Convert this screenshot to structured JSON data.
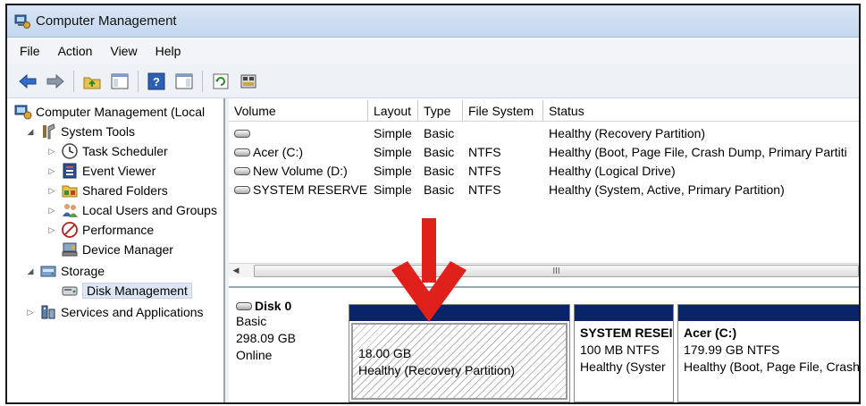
{
  "window": {
    "title": "Computer Management"
  },
  "menu": [
    "File",
    "Action",
    "View",
    "Help"
  ],
  "tree": {
    "root": "Computer Management (Local",
    "system_tools": "System Tools",
    "task_scheduler": "Task Scheduler",
    "event_viewer": "Event Viewer",
    "shared_folders": "Shared Folders",
    "local_users": "Local Users and Groups",
    "performance": "Performance",
    "device_manager": "Device Manager",
    "storage": "Storage",
    "disk_management": "Disk Management",
    "services": "Services and Applications"
  },
  "volumes": {
    "columns": [
      "Volume",
      "Layout",
      "Type",
      "File System",
      "Status"
    ],
    "rows": [
      {
        "volume": "",
        "layout": "Simple",
        "type": "Basic",
        "fs": "",
        "status": "Healthy (Recovery Partition)"
      },
      {
        "volume": "Acer (C:)",
        "layout": "Simple",
        "type": "Basic",
        "fs": "NTFS",
        "status": "Healthy (Boot, Page File, Crash Dump, Primary Partiti"
      },
      {
        "volume": "New Volume (D:)",
        "layout": "Simple",
        "type": "Basic",
        "fs": "NTFS",
        "status": "Healthy (Logical Drive)"
      },
      {
        "volume": "SYSTEM RESERVED",
        "layout": "Simple",
        "type": "Basic",
        "fs": "NTFS",
        "status": "Healthy (System, Active, Primary Partition)"
      }
    ]
  },
  "scroll": {
    "grip": "III"
  },
  "disk": {
    "name": "Disk 0",
    "type": "Basic",
    "size": "298.09 GB",
    "state": "Online",
    "partitions": [
      {
        "name": "",
        "size": "18.00 GB",
        "status": "Healthy (Recovery Partition)"
      },
      {
        "name": "SYSTEM RESEI",
        "size": "100 MB NTFS",
        "status": "Healthy (Syster"
      },
      {
        "name": "Acer  (C:)",
        "size": "179.99 GB NTFS",
        "status": "Healthy (Boot, Page File, Crash"
      }
    ]
  },
  "colors": {
    "partition_cap": "#0a246a",
    "arrow": "#e0201b",
    "titlebar": "#c9dbf1"
  },
  "icons": [
    "computer-management-icon",
    "back-icon",
    "forward-icon",
    "up-folder-icon",
    "console-tree-icon",
    "help-icon",
    "properties-icon",
    "refresh-icon",
    "disk-icon"
  ]
}
